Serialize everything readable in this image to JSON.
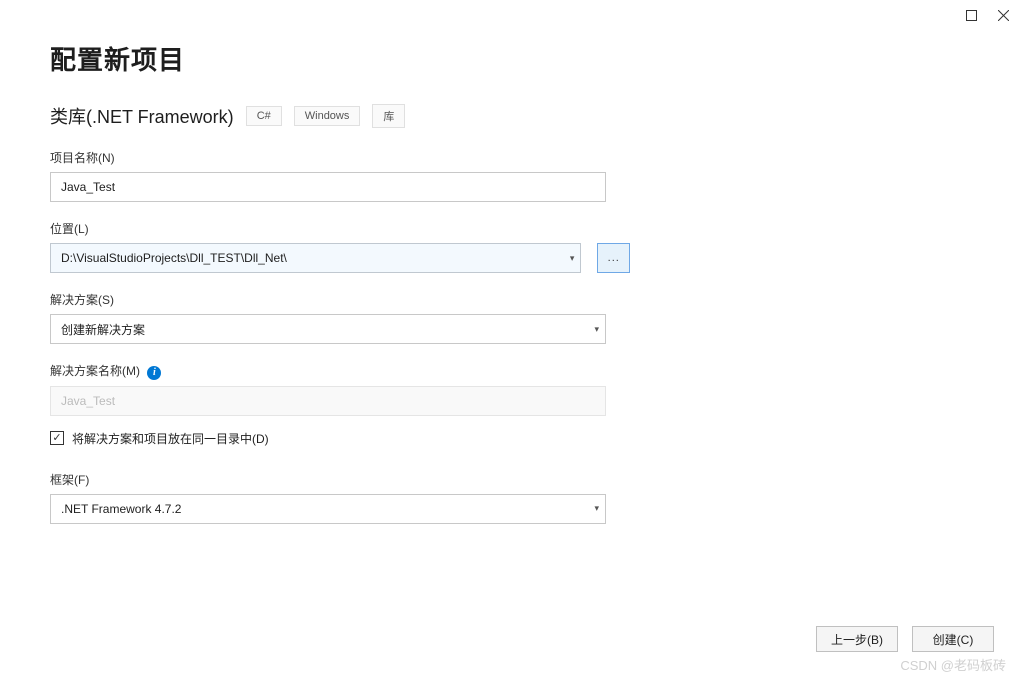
{
  "title": "配置新项目",
  "subtitle": "类库(.NET Framework)",
  "tags": [
    "C#",
    "Windows",
    "库"
  ],
  "labels": {
    "projectName": "项目名称(N)",
    "location": "位置(L)",
    "solution": "解决方案(S)",
    "solutionName": "解决方案名称(M)",
    "framework": "框架(F)"
  },
  "values": {
    "projectName": "Java_Test",
    "location": "D:\\VisualStudioProjects\\Dll_TEST\\Dll_Net\\",
    "solution": "创建新解决方案",
    "solutionName": "Java_Test",
    "framework": ".NET Framework 4.7.2"
  },
  "browseLabel": "...",
  "checkbox": {
    "checked": true,
    "label": "将解决方案和项目放在同一目录中(D)"
  },
  "buttons": {
    "back": "上一步(B)",
    "create": "创建(C)"
  },
  "watermark": "CSDN @老码板砖"
}
